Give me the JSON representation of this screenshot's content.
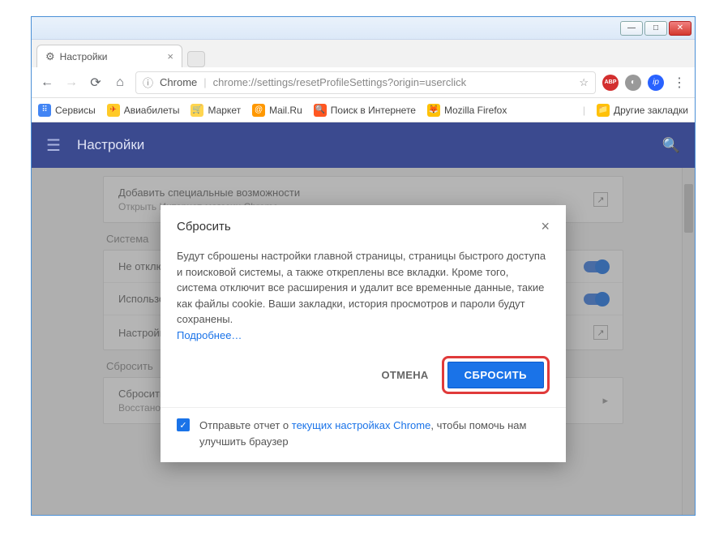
{
  "window": {
    "tab_title": "Настройки",
    "chrome_label": "Chrome",
    "url": "chrome://settings/resetProfileSettings?origin=userclick"
  },
  "bookmarks": {
    "services": "Сервисы",
    "air": "Авиабилеты",
    "market": "Маркет",
    "mail": "Mail.Ru",
    "search": "Поиск в Интернете",
    "firefox": "Mozilla Firefox",
    "other": "Другие закладки"
  },
  "settings": {
    "title": "Настройки",
    "accessibility": {
      "title": "Добавить специальные возможности",
      "sub": "Открыть Интернет-магазин Chrome"
    },
    "system_label": "Система",
    "row1": "Не отключать",
    "row2": "Использовать",
    "row3": "Настройки",
    "reset_label": "Сбросить",
    "reset_row": {
      "title": "Сбросить",
      "sub": "Восстановление настроек по умолчанию"
    }
  },
  "dialog": {
    "title": "Сбросить",
    "body": "Будут сброшены настройки главной страницы, страницы быстрого доступа и поисковой системы, а также откреплены все вкладки. Кроме того, система отключит все расширения и удалит все временные данные, такие как файлы cookie. Ваши закладки, история просмотров и пароли будут сохранены.",
    "more": "Подробнее…",
    "cancel": "ОТМЕНА",
    "confirm": "СБРОСИТЬ",
    "report_prefix": "Отправьте отчет о ",
    "report_link": "текущих настройках Chrome",
    "report_suffix": ", чтобы помочь нам улучшить браузер"
  }
}
